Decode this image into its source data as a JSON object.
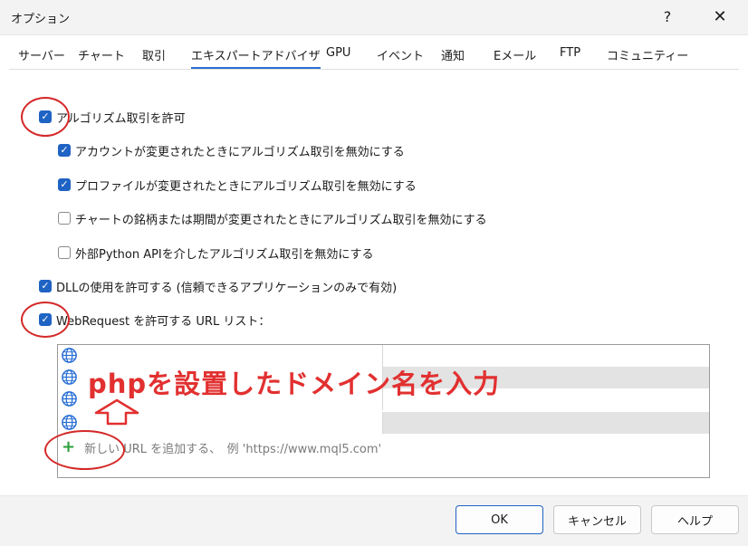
{
  "window": {
    "title": "オプション",
    "help_glyph": "?",
    "close_glyph": "✕"
  },
  "tabs": [
    {
      "label": "サーバー"
    },
    {
      "label": "チャート"
    },
    {
      "label": "取引"
    },
    {
      "label": "エキスパートアドバイザ",
      "active": true
    },
    {
      "label": "GPU"
    },
    {
      "label": "イベント"
    },
    {
      "label": "通知"
    },
    {
      "label": "Eメール"
    },
    {
      "label": "FTP"
    },
    {
      "label": "コミュニティー"
    }
  ],
  "options": {
    "allow_algo": {
      "label": "アルゴリズム取引を許可",
      "checked": true
    },
    "disable_on_account": {
      "label": "アカウントが変更されたときにアルゴリズム取引を無効にする",
      "checked": true
    },
    "disable_on_profile": {
      "label": "プロファイルが変更されたときにアルゴリズム取引を無効にする",
      "checked": true
    },
    "disable_on_symbol": {
      "label": "チャートの銘柄または期間が変更されたときにアルゴリズム取引を無効にする",
      "checked": false
    },
    "disable_on_python": {
      "label": "外部Python APIを介したアルゴリズム取引を無効にする",
      "checked": false
    },
    "allow_dll": {
      "label": "DLLの使用を許可する (信頼できるアプリケーションのみで有効)",
      "checked": true
    },
    "allow_webrequest": {
      "label": "WebRequest を許可する URL リスト：",
      "checked": true
    }
  },
  "url_list": {
    "rows": 4,
    "add_label": "新しい URL を追加する、　例 'https://www.mql5.com'"
  },
  "annotation": {
    "text": "phpを設置したドメイン名を入力",
    "color": "#e23030"
  },
  "icons": {
    "check": "✓",
    "plus": "+"
  },
  "footer": {
    "ok": "OK",
    "cancel": "キャンセル",
    "help": "ヘルプ"
  },
  "colors": {
    "accent": "#1f63c4",
    "annotation_red": "#d42828",
    "add_green": "#2aa03a"
  }
}
